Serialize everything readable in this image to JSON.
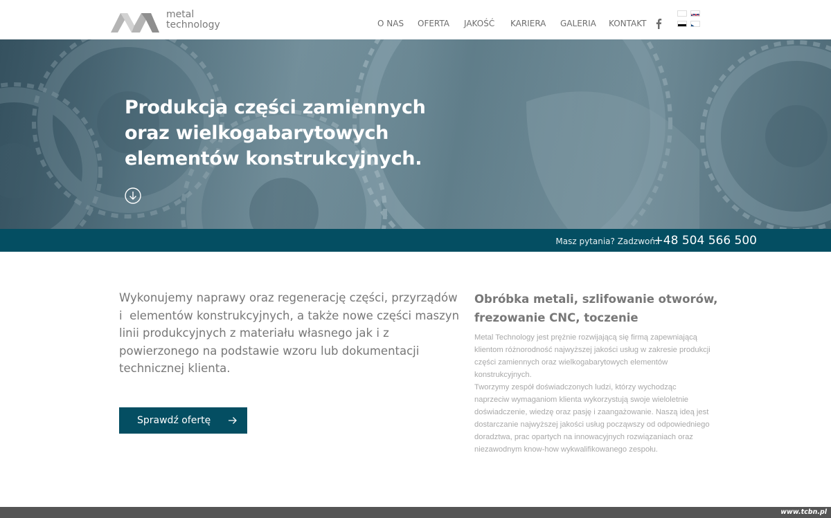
{
  "brand": {
    "logo_line1": "metal",
    "logo_line2": "technology",
    "logo_color": "#9a9a9a"
  },
  "nav": {
    "items": [
      {
        "label": "O NAS"
      },
      {
        "label": "OFERTA"
      },
      {
        "label": "JAKOŚĆ"
      },
      {
        "label": "KARIERA"
      },
      {
        "label": "GALERIA"
      },
      {
        "label": "KONTAKT"
      }
    ],
    "social_icon": "facebook-icon",
    "languages": [
      "pl",
      "en",
      "de",
      "cz"
    ]
  },
  "hero": {
    "title_lines": [
      "Produkcja części zamiennych",
      "oraz wielkogabarytowych",
      "elementów konstrukcyjnych."
    ],
    "scroll_icon": "arrow-down-circle-icon"
  },
  "callbar": {
    "label": "Masz pytania? Zadzwoń:",
    "phone": "+48 504 566 500",
    "background": "#044e62"
  },
  "intro": {
    "lines": [
      "Wykonujemy naprawy oraz regenerację części, przyrządów",
      "i  elementów konstrukcyjnych, a także nowe części maszyn",
      "linii produkcyjnych z materiału własnego jak i z",
      "powierzonego na podstawie wzoru lub dokumentacji",
      "technicznej klienta."
    ],
    "cta_label": "Sprawdź ofertę",
    "cta_icon": "arrow-right-icon"
  },
  "about": {
    "heading_lines": [
      "Obróbka metali, szlifowanie otworów,",
      "frezowanie CNC, toczenie"
    ],
    "paragraph1": "Metal Technology jest prężnie rozwijającą się firmą zapewniającą klientom różnorodność najwyższej jakości usług w zakresie produkcji części zamiennych oraz wielkogabarytowych elementów konstrukcyjnych.",
    "paragraph2": "Tworzymy zespół doświadczonych ludzi, którzy wychodząc naprzeciw wymaganiom klienta wykorzystują swoje wieloletnie doświadczenie, wiedzę oraz pasję i zaangażowanie. Naszą ideą jest dostarczanie najwyższej jakości usług począwszy od odpowiedniego doradztwa, prac opartych na innowacyjnych rozwiązaniach oraz niezawodnym know-how wykwalifikowanego zespołu."
  },
  "footer": {
    "watermark": "www.tcbn.pl"
  }
}
